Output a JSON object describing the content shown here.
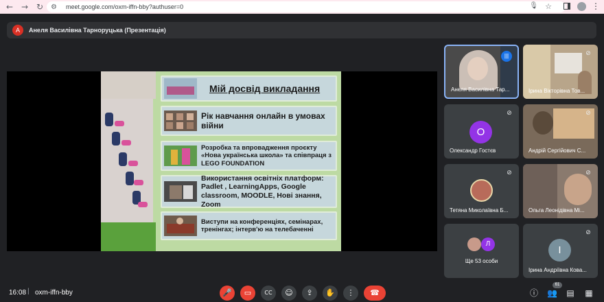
{
  "browser": {
    "url": "meet.google.com/oxm-iffn-bby?authuser=0",
    "back": "←",
    "forward": "→",
    "reload": "↻",
    "profile_letter": "",
    "menu": "⋮"
  },
  "presenter": {
    "avatar_letter": "A",
    "title": "Анеля Василівна Тарноруцька (Презентація)"
  },
  "slide": {
    "heading": "Мій досвід викладання",
    "items": [
      "Рік навчання онлайн в умовах війни",
      "Розробка та  впровадження проєкту «Нова українська школа» та співпраця з LEGO FOUNDATION",
      "Використання освітніх платформ: Padlet , LearningApps, Google classroom, MOODLE, Нові знання, Zoom",
      "Виступи на конференціях, семінарах, тренінгах; інтерв'ю на телебаченні"
    ]
  },
  "participants": [
    {
      "name": "Анеля Василівна Тар...",
      "type": "video",
      "speaking": true
    },
    {
      "name": "Ірина Вікторівна Тов...",
      "type": "video",
      "muted": true
    },
    {
      "name": "Олександр Гостєв",
      "type": "avatar",
      "letter": "О",
      "color": "#9334e6",
      "muted": true
    },
    {
      "name": "Андрій Сергійович С...",
      "type": "video",
      "muted": true
    },
    {
      "name": "Тетяна Миколаївна Б...",
      "type": "photo",
      "muted": true
    },
    {
      "name": "Ольга Леонідівна Мі...",
      "type": "video",
      "muted": true
    },
    {
      "name": "Ще 53 особи",
      "type": "group",
      "letter": "Л"
    },
    {
      "name": "Ірина Андріївна Кова...",
      "type": "avatar",
      "letter": "І",
      "color": "#78909c",
      "muted": true
    }
  ],
  "bottom": {
    "time": "16:08",
    "separator": "|",
    "meeting_code": "oxm-iffn-bby",
    "participant_count": "61"
  },
  "controls": {
    "mic": "mic-off-icon",
    "cam": "camera-off-icon",
    "cc": "captions-icon",
    "emoji": "emoji-icon",
    "present": "present-icon",
    "hand": "raise-hand-icon",
    "more": "more-icon",
    "hangup": "hang-up-icon"
  },
  "colors": {
    "accent_red": "#ea4335",
    "control_grey": "#3c4043",
    "speaking_blue": "#1a73e8"
  }
}
